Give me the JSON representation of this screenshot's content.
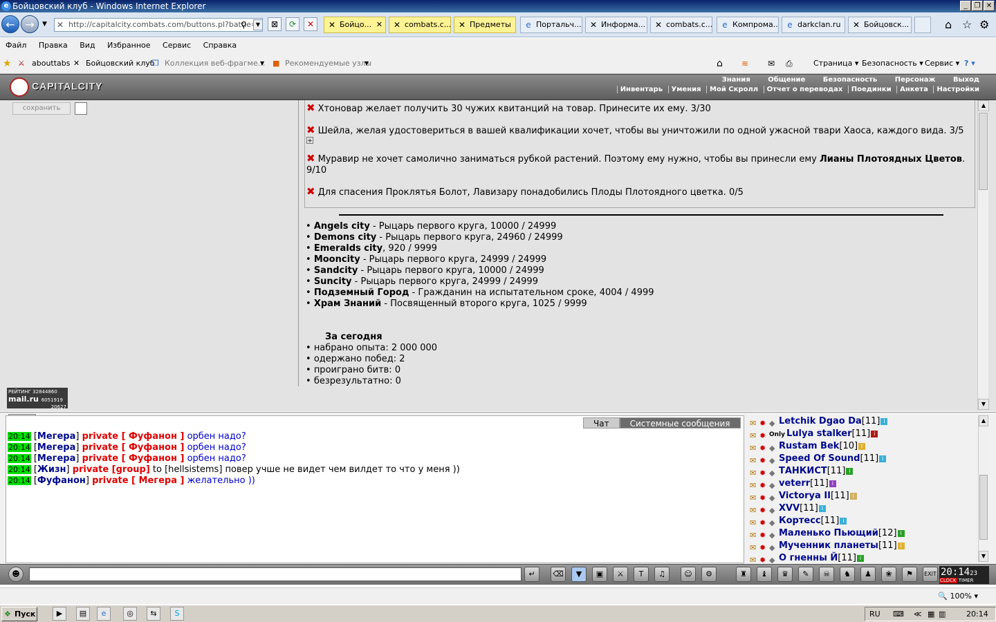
{
  "window": {
    "title": "Бойцовский клуб - Windows Internet Explorer"
  },
  "browser": {
    "address": "http://capitalcity.combats.com/buttons.pl?battle=0",
    "tabs": [
      {
        "label": "Бойцо...",
        "active": true
      },
      {
        "label": "combats.c..."
      },
      {
        "label": "Предметы"
      },
      {
        "label": "Портальч..."
      },
      {
        "label": "Информа..."
      },
      {
        "label": "combats.c..."
      },
      {
        "label": "Компрома..."
      },
      {
        "label": "darkclan.ru"
      },
      {
        "label": "Бойцовск..."
      }
    ],
    "menu": [
      "Файл",
      "Правка",
      "Вид",
      "Избранное",
      "Сервис",
      "Справка"
    ],
    "favorites": [
      "abouttabs",
      "Бойцовский клуб",
      "Коллекция веб-фрагме...",
      "Рекомендуемые узлы"
    ],
    "command_items": [
      "Страница",
      "Безопасность",
      "Сервис"
    ],
    "zoom": "100%"
  },
  "game_header": {
    "logo": "CAPITALCITY",
    "top_menu": [
      "Знания",
      "Общение",
      "Безопасность",
      "Персонаж",
      "Выход"
    ],
    "bottom_menu": [
      "Инвентарь",
      "Умения",
      "Мой Скролл",
      "Отчет о переводах",
      "Поединки",
      "Анкета",
      "Настройки"
    ]
  },
  "left_panel": {
    "save_button": "сохранить",
    "rating": {
      "label": "РЕЙТИНГ",
      "id": "32844860",
      "brand": "mail.ru",
      "num1": "6051919",
      "num2": "20627"
    }
  },
  "quests": [
    {
      "text": "Хтоновар желает получить 30 чужих квитанций на товар. Принесите их ему. 3/30"
    },
    {
      "text": "Шейла, желая удостовериться в вашей квалификации хочет, чтобы вы уничтожили по одной ужасной твари Хаоса, каждого вида. 3/5"
    },
    {
      "text_pre": "Муравир не хочет самолично заниматься рубкой растений. Поэтому ему нужно, чтобы вы принесли ему ",
      "text_bold": "Лианы Плотоядных Цветов",
      "text_post": ". 9/10"
    },
    {
      "text": "Для спасения Проклятья Болот, Лавизару понадобились Плоды Плотоядного цветка. 0/5"
    }
  ],
  "cities": [
    {
      "name": "Angels city",
      "desc": " - Рыцарь первого круга, 10000 / 24999"
    },
    {
      "name": "Demons city",
      "desc": " - Рыцарь первого круга, 24960 / 24999"
    },
    {
      "name": "Emeralds city",
      "desc": ", 920 / 9999"
    },
    {
      "name": "Mooncity",
      "desc": " - Рыцарь первого круга, 24999 / 24999"
    },
    {
      "name": "Sandcity",
      "desc": " - Рыцарь первого круга, 10000 / 24999"
    },
    {
      "name": "Suncity",
      "desc": " - Рыцарь первого круга, 24999 / 24999"
    },
    {
      "name": "Подземный Город",
      "desc": " - Гражданин на испытательном сроке, 4004 / 4999"
    },
    {
      "name": "Храм Знаний",
      "desc": " - Посвященный второго круга, 1025 / 9999"
    }
  ],
  "today": {
    "title": "За сегодня",
    "items": [
      "набрано опыта: 2 000 000",
      "одержано побед: 2",
      "проиграно битв: 0",
      "безрезультатно: 0"
    ]
  },
  "chat": {
    "tabs": [
      "Чат",
      "Системные сообщения"
    ],
    "messages": [
      {
        "time": "20:14",
        "nick": "Мегера",
        "private": "private [ Фуфанон ]",
        "msg": "орбен надо?"
      },
      {
        "time": "20:14",
        "nick": "Мегера",
        "private": "private [ Фуфанон ]",
        "msg": "орбен надо?"
      },
      {
        "time": "20:14",
        "nick": "Мегера",
        "private": "private [ Фуфанон ]",
        "msg": "орбен надо?"
      },
      {
        "time": "20:14",
        "nick": "Жизн",
        "private": "private [group]",
        "msg": "to [hellsistems] повер учше не видет чем вилдет то что у меня ))"
      },
      {
        "time": "20:14",
        "nick": "Фуфанон",
        "private": "private [ Мегера ]",
        "msg": "желательно ))"
      }
    ]
  },
  "userlist": [
    {
      "name": "Letchik Dgao Da",
      "level": "[11]",
      "info": "#3ab0d8"
    },
    {
      "name": "Lulya stalker",
      "level": "[11]",
      "info": "#b01818",
      "prefix": "Only"
    },
    {
      "name": "Rustam Bek",
      "level": "[10]",
      "info": "#e0b030"
    },
    {
      "name": "Speed Of Sound",
      "level": "[11]",
      "info": "#3ab0d8"
    },
    {
      "name": "ТАНКИСТ",
      "level": "[11]",
      "info": "#28a028"
    },
    {
      "name": "veterr",
      "level": "[11]",
      "info": "#9040c0"
    },
    {
      "name": "Victorya II",
      "level": "[11]",
      "info": "#d0b060"
    },
    {
      "name": "XVV",
      "level": "[11]",
      "info": "#3ab0d8"
    },
    {
      "name": "Кортесс",
      "level": "[11]",
      "info": "#3ab0d8"
    },
    {
      "name": "Маленько Пьющий",
      "level": "[12]",
      "info": "#28a028"
    },
    {
      "name": "Мученник планеты",
      "level": "[11]",
      "info": "#e0b030"
    },
    {
      "name": "О гненны Й",
      "level": "[11]",
      "info": "#28a028"
    }
  ],
  "clock": {
    "time": "20:14",
    "seconds": "23",
    "labels": [
      "CLOCK",
      "TIMER"
    ]
  },
  "taskbar": {
    "start": "Пуск",
    "lang": "RU",
    "time": "20:14"
  }
}
